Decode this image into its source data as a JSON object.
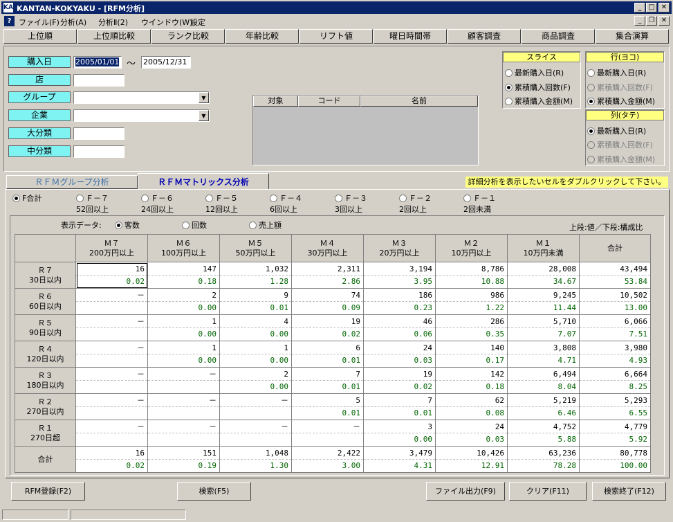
{
  "window": {
    "title": "KANTAN-KOKYAKU - [RFM分析]"
  },
  "menu": [
    "ファイル(F)",
    "分析(A)",
    "分析Ⅱ(2)",
    "ウインドウ(W)",
    "設定"
  ],
  "toolbar": [
    "上位順",
    "上位順比較",
    "ランク比較",
    "年齢比較",
    "リフト値",
    "曜日時間帯",
    "顧客調査",
    "商品調査",
    "集合演算"
  ],
  "criteria": {
    "date_label": "購入日",
    "date_from": "2005/01/01",
    "tilde": "～",
    "date_to": "2005/12/31",
    "store_label": "店",
    "group_label": "グループ",
    "company_label": "企業",
    "major_label": "大分類",
    "minor_label": "中分類"
  },
  "target_list": {
    "headers": [
      "対象",
      "コード",
      "名前"
    ]
  },
  "slice": {
    "title": "スライス",
    "options": [
      "最新購入日(R)",
      "累積購入回数(F)",
      "累積購入金額(M)"
    ],
    "selected": 1
  },
  "row_axis": {
    "title": "行(ヨコ)",
    "options": [
      "最新購入日(R)",
      "累積購入回数(F)",
      "累積購入金額(M)"
    ],
    "selected": 2
  },
  "col_axis": {
    "title": "列(タテ)",
    "options": [
      "最新購入日(R)",
      "累積購入回数(F)",
      "累積購入金額(M)"
    ],
    "selected": 0
  },
  "tabs": {
    "group": "ＲＦＭグループ分析",
    "matrix": "ＲＦＭマトリックス分析",
    "hint": "詳細分析を表示したいセルをダブルクリックして下さい。"
  },
  "f_filters": [
    {
      "label": "F合計",
      "sub": ""
    },
    {
      "label": "Ｆ－７",
      "sub": "52回以上"
    },
    {
      "label": "Ｆ－６",
      "sub": "24回以上"
    },
    {
      "label": "Ｆ－５",
      "sub": "12回以上"
    },
    {
      "label": "Ｆ－４",
      "sub": "6回以上"
    },
    {
      "label": "Ｆ－３",
      "sub": "3回以上"
    },
    {
      "label": "Ｆ－２",
      "sub": "2回以上"
    },
    {
      "label": "Ｆ－１",
      "sub": "2回未満"
    }
  ],
  "display": {
    "label": "表示データ:",
    "options": [
      "客数",
      "回数",
      "売上額"
    ],
    "selected": 0,
    "legend": "上段:値／下段:構成比"
  },
  "matrix": {
    "columns": [
      {
        "name": "Ｍ７",
        "sub": "200万円以上"
      },
      {
        "name": "Ｍ６",
        "sub": "100万円以上"
      },
      {
        "name": "Ｍ５",
        "sub": "50万円以上"
      },
      {
        "name": "Ｍ４",
        "sub": "30万円以上"
      },
      {
        "name": "Ｍ３",
        "sub": "20万円以上"
      },
      {
        "name": "Ｍ２",
        "sub": "10万円以上"
      },
      {
        "name": "Ｍ１",
        "sub": "10万円未満"
      },
      {
        "name": "合計",
        "sub": ""
      }
    ],
    "rows": [
      {
        "name": "Ｒ７",
        "sub": "30日以内",
        "values": [
          "16",
          "147",
          "1,032",
          "2,311",
          "3,194",
          "8,786",
          "28,008",
          "43,494"
        ],
        "ratios": [
          "0.02",
          "0.18",
          "1.28",
          "2.86",
          "3.95",
          "10.88",
          "34.67",
          "53.84"
        ]
      },
      {
        "name": "Ｒ６",
        "sub": "60日以内",
        "values": [
          "－",
          "2",
          "9",
          "74",
          "186",
          "986",
          "9,245",
          "10,502"
        ],
        "ratios": [
          "",
          "0.00",
          "0.01",
          "0.09",
          "0.23",
          "1.22",
          "11.44",
          "13.00"
        ]
      },
      {
        "name": "Ｒ５",
        "sub": "90日以内",
        "values": [
          "－",
          "1",
          "4",
          "19",
          "46",
          "286",
          "5,710",
          "6,066"
        ],
        "ratios": [
          "",
          "0.00",
          "0.00",
          "0.02",
          "0.06",
          "0.35",
          "7.07",
          "7.51"
        ]
      },
      {
        "name": "Ｒ４",
        "sub": "120日以内",
        "values": [
          "－",
          "1",
          "1",
          "6",
          "24",
          "140",
          "3,808",
          "3,980"
        ],
        "ratios": [
          "",
          "0.00",
          "0.00",
          "0.01",
          "0.03",
          "0.17",
          "4.71",
          "4.93"
        ]
      },
      {
        "name": "Ｒ３",
        "sub": "180日以内",
        "values": [
          "－",
          "－",
          "2",
          "7",
          "19",
          "142",
          "6,494",
          "6,664"
        ],
        "ratios": [
          "",
          "",
          "0.00",
          "0.01",
          "0.02",
          "0.18",
          "8.04",
          "8.25"
        ]
      },
      {
        "name": "Ｒ２",
        "sub": "270日以内",
        "values": [
          "－",
          "－",
          "－",
          "5",
          "7",
          "62",
          "5,219",
          "5,293"
        ],
        "ratios": [
          "",
          "",
          "",
          "0.01",
          "0.01",
          "0.08",
          "6.46",
          "6.55"
        ]
      },
      {
        "name": "Ｒ１",
        "sub": "270日超",
        "values": [
          "－",
          "－",
          "－",
          "－",
          "3",
          "24",
          "4,752",
          "4,779"
        ],
        "ratios": [
          "",
          "",
          "",
          "",
          "0.00",
          "0.03",
          "5.88",
          "5.92"
        ]
      },
      {
        "name": "合計",
        "sub": "",
        "values": [
          "16",
          "151",
          "1,048",
          "2,422",
          "3,479",
          "10,426",
          "63,236",
          "80,778"
        ],
        "ratios": [
          "0.02",
          "0.19",
          "1.30",
          "3.00",
          "4.31",
          "12.91",
          "78.28",
          "100.00"
        ]
      }
    ]
  },
  "buttons": {
    "rfm_register": "RFM登録(F2)",
    "search": "検索(F5)",
    "file_output": "ファイル出力(F9)",
    "clear": "クリア(F11)",
    "end": "検索終了(F12)"
  }
}
